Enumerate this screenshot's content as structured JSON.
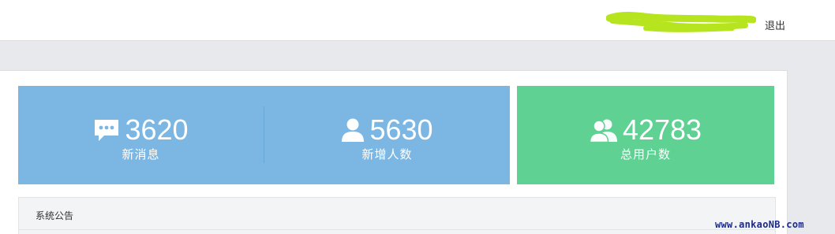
{
  "header": {
    "logout_label": "退出"
  },
  "stats": [
    {
      "icon": "chat-bubble-icon",
      "value": "3620",
      "label": "新消息"
    },
    {
      "icon": "user-icon",
      "value": "5630",
      "label": "新增人数"
    },
    {
      "icon": "users-icon",
      "value": "42783",
      "label": "总用户数"
    }
  ],
  "notice": {
    "title": "系统公告"
  },
  "watermark": "www.ankaoNB.com",
  "colors": {
    "blue_panel": "#7cb7e4",
    "green_panel": "#5fd193",
    "redaction_scribble": "#b6e51f"
  }
}
